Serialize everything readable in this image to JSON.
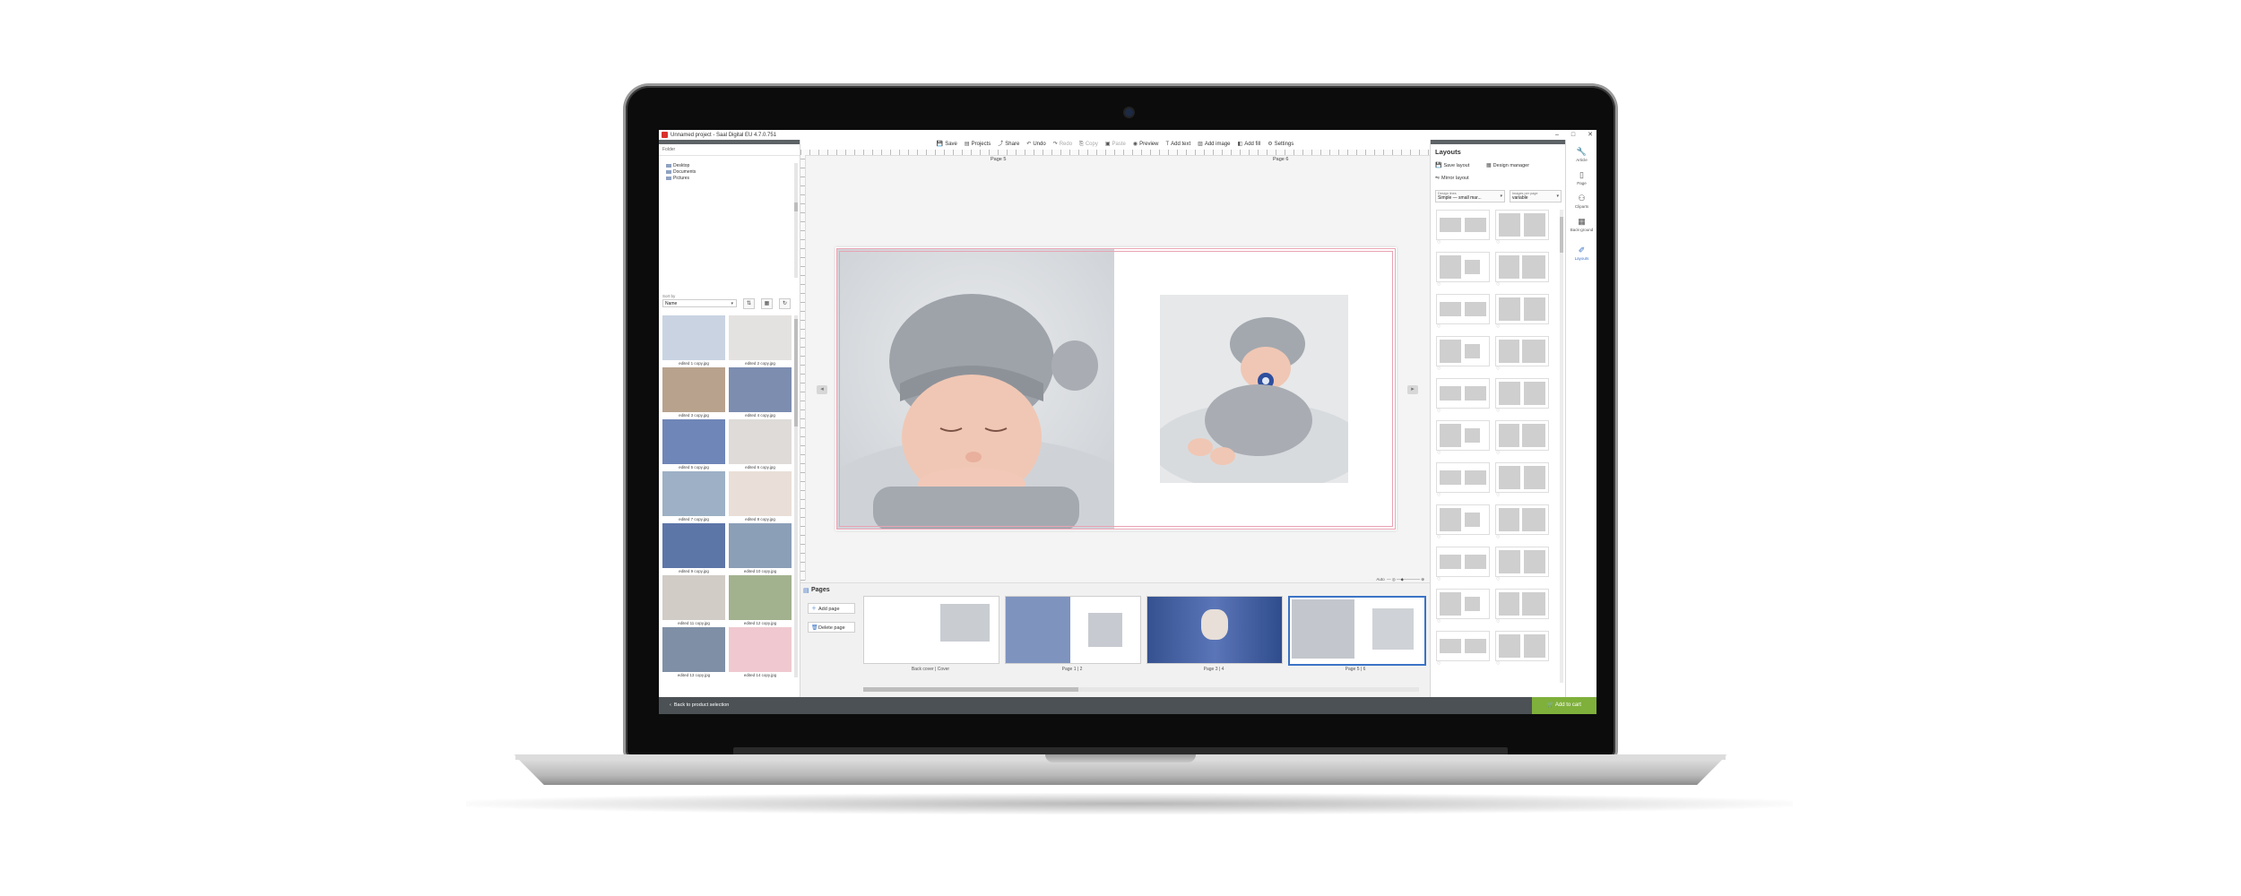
{
  "window": {
    "title": "Unnamed project - Saal Digital EU 4.7.0.751",
    "controls": [
      "–",
      "□",
      "✕"
    ]
  },
  "left_panel": {
    "folder_label": "Folder",
    "tree": [
      "Desktop",
      "Documents",
      "Pictures"
    ],
    "sort_label": "Sort by",
    "sort_value": "Name",
    "images": [
      {
        "caption": "edited 1 copy.jpg",
        "color": "#c9d3e2"
      },
      {
        "caption": "edited 2 copy.jpg",
        "color": "#e4e2e0"
      },
      {
        "caption": "edited 3 copy.jpg",
        "color": "#b8a28e"
      },
      {
        "caption": "edited 4 copy.jpg",
        "color": "#7d8db0"
      },
      {
        "caption": "edited 5 copy.jpg",
        "color": "#6f86b8"
      },
      {
        "caption": "edited 6 copy.jpg",
        "color": "#dedbd8"
      },
      {
        "caption": "edited 7 copy.jpg",
        "color": "#9db0c5"
      },
      {
        "caption": "edited 8 copy.jpg",
        "color": "#e9dfd8"
      },
      {
        "caption": "edited 9 copy.jpg",
        "color": "#5d76a8"
      },
      {
        "caption": "edited 10 copy.jpg",
        "color": "#8b9fb7"
      },
      {
        "caption": "edited 11 copy.jpg",
        "color": "#d1ccc6"
      },
      {
        "caption": "edited 12 copy.jpg",
        "color": "#a2b28e"
      },
      {
        "caption": "edited 13 copy.jpg",
        "color": "#7f90a6"
      },
      {
        "caption": "edited 14 copy.jpg",
        "color": "#efc9cf"
      }
    ],
    "back_label": "Back to product selection"
  },
  "toolbar": {
    "items": [
      {
        "label": "Save",
        "icon": "💾",
        "disabled": false
      },
      {
        "label": "Projects",
        "icon": "▤",
        "disabled": false
      },
      {
        "label": "Share",
        "icon": "⤴",
        "disabled": false
      },
      {
        "label": "Undo",
        "icon": "↶",
        "disabled": false
      },
      {
        "label": "Redo",
        "icon": "↷",
        "disabled": true
      },
      {
        "label": "Copy",
        "icon": "⎘",
        "disabled": true
      },
      {
        "label": "Paste",
        "icon": "▣",
        "disabled": true
      },
      {
        "label": "Preview",
        "icon": "◉",
        "disabled": false
      },
      {
        "label": "Add text",
        "icon": "T",
        "disabled": false
      },
      {
        "label": "Add image",
        "icon": "▨",
        "disabled": false
      },
      {
        "label": "Add fill",
        "icon": "◧",
        "disabled": false
      },
      {
        "label": "Settings",
        "icon": "⚙",
        "disabled": false
      }
    ]
  },
  "canvas": {
    "left_page_label": "Page 5",
    "right_page_label": "Page 6"
  },
  "pages": {
    "title": "Pages",
    "add_label": "Add page",
    "delete_label": "Delete page",
    "zoom_label": "Auto",
    "thumbs": [
      {
        "caption": "Back cover | Cover"
      },
      {
        "caption": "Page 1 | 2"
      },
      {
        "caption": "Page 3 | 4"
      },
      {
        "caption": "Page 5 | 6"
      }
    ]
  },
  "layouts": {
    "title": "Layouts",
    "save_layout": "Save layout",
    "design_manager": "Design manager",
    "mirror_layout": "Mirror layout",
    "design_lines_label": "Design lines",
    "design_lines_value": "Simple — small mar...",
    "images_per_page_label": "Images per page",
    "images_per_page_value": "variable"
  },
  "rail": [
    {
      "label": "Article",
      "icon": "✎"
    },
    {
      "label": "Page",
      "icon": "▯"
    },
    {
      "label": "Cliparts",
      "icon": "☁"
    },
    {
      "label": "Back-ground",
      "icon": "▦"
    },
    {
      "label": "Layouts",
      "icon": "✐"
    }
  ],
  "cart_label": "Add to cart",
  "colors": {
    "accent": "#3b73c6",
    "cart": "#7fb03b",
    "dark_bar": "#4c5155",
    "bleed_line": "#e8a3b3"
  }
}
